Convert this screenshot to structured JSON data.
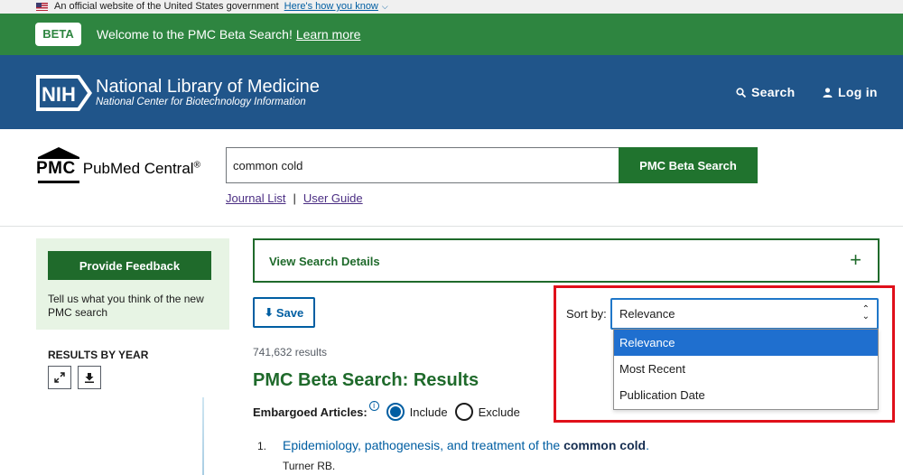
{
  "gov_banner": {
    "text": "An official website of the United States government",
    "link": "Here's how you know"
  },
  "beta_banner": {
    "badge": "BETA",
    "text": "Welcome to the PMC Beta Search!",
    "link": "Learn more"
  },
  "nih_header": {
    "logo_text": "NIH",
    "title": "National Library of Medicine",
    "subtitle": "National Center for Biotechnology Information",
    "search_label": "Search",
    "login_label": "Log in"
  },
  "pmc": {
    "abbr": "PMC",
    "name": "PubMed Central",
    "reg": "®",
    "search_value": "common cold",
    "search_button": "PMC Beta Search",
    "links": [
      "Journal List",
      "User Guide"
    ],
    "link_sep": "|"
  },
  "sidebar": {
    "feedback_button": "Provide Feedback",
    "feedback_text": "Tell us what you think of the new PMC search",
    "results_by_year": "RESULTS BY YEAR"
  },
  "main": {
    "details_label": "View Search Details",
    "details_plus": "+",
    "save_label": "Save",
    "results_count": "741,632 results",
    "results_title": "PMC Beta Search: Results",
    "embargo_label": "Embargoed Articles:",
    "include_label": "Include",
    "exclude_label": "Exclude",
    "embargo_selected": "Include",
    "results": [
      {
        "num": "1.",
        "title_prefix": "Epidemiology, pathogenesis, and treatment of the ",
        "title_bold": "common cold",
        "title_suffix": ".",
        "authors": "Turner RB."
      }
    ]
  },
  "sort": {
    "label": "Sort by:",
    "selected": "Relevance",
    "options": [
      "Relevance",
      "Most Recent",
      "Publication Date"
    ]
  },
  "colors": {
    "beta_green": "#2e8540",
    "nih_blue": "#20558a",
    "pmc_green": "#1f6a2b",
    "link_blue": "#005ea2",
    "highlight_red": "#e0101a",
    "option_selected": "#1f6fcf"
  }
}
